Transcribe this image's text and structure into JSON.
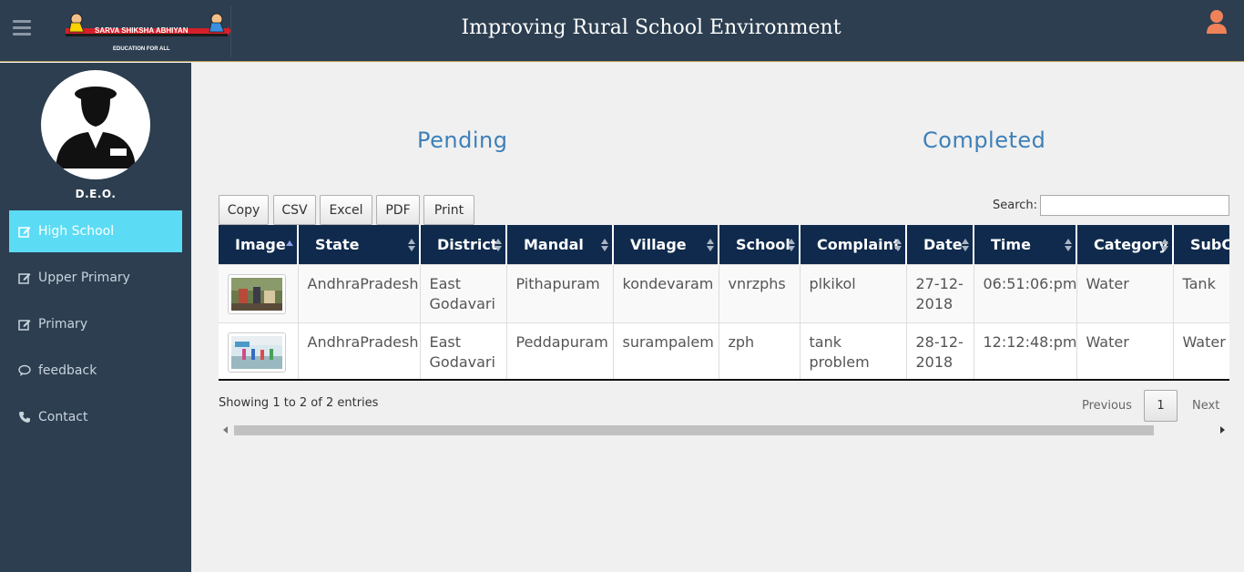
{
  "header": {
    "title": "Improving Rural School Environment",
    "logo_text": "SARVA SHIKSHA ABHIYAN",
    "logo_tagline": "EDUCATION FOR ALL"
  },
  "sidebar": {
    "role": "D.E.O.",
    "items": [
      {
        "label": "High School",
        "icon": "edit-icon",
        "active": true
      },
      {
        "label": "Upper Primary",
        "icon": "edit-icon"
      },
      {
        "label": "Primary",
        "icon": "edit-icon"
      },
      {
        "label": "feedback",
        "icon": "comment-icon"
      },
      {
        "label": "Contact",
        "icon": "phone-icon"
      }
    ]
  },
  "main": {
    "tabs": [
      "Pending",
      "Completed"
    ],
    "buttons": [
      "Copy",
      "CSV",
      "Excel",
      "PDF",
      "Print"
    ],
    "search_label": "Search:",
    "search_value": "",
    "table": {
      "columns": [
        "Image",
        "State",
        "District",
        "Mandal",
        "Village",
        "School",
        "Complaint",
        "Date",
        "Time",
        "Category",
        "SubCa"
      ],
      "rows": [
        {
          "state": "AndhraPradesh",
          "district": "East Godavari",
          "mandal": "Pithapuram",
          "village": "kondevaram",
          "school": "vnrzphs",
          "complaint": "plkikol",
          "date": "27-12-2018",
          "time": "06:51:06:pm",
          "category": "Water",
          "subcategory": "Tank"
        },
        {
          "state": "AndhraPradesh",
          "district": "East Godavari",
          "mandal": "Peddapuram",
          "village": "surampalem",
          "school": "zph",
          "complaint": "tank problem",
          "date": "28-12-2018",
          "time": "12:12:48:pm",
          "category": "Water",
          "subcategory": "Water"
        }
      ]
    },
    "info": "Showing 1 to 2 of 2 entries",
    "pagination": {
      "previous": "Previous",
      "current": "1",
      "next": "Next"
    }
  },
  "colors": {
    "header_bg": "#2c3e50",
    "sidebar_bg": "#2c3e50",
    "active_nav": "#5bdcf4",
    "table_header": "#0f2a4d",
    "link": "#3d80b8",
    "user_icon": "#f0825a"
  }
}
